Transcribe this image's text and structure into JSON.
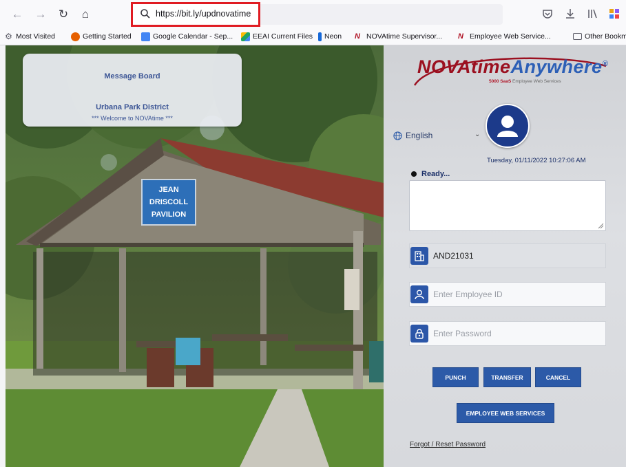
{
  "browser": {
    "url": "https://bit.ly/updnovatime",
    "bookmarks": [
      {
        "label": "Most Visited",
        "icon": "gear-icon",
        "color": "#5b5b66"
      },
      {
        "label": "Getting Started",
        "icon": "firefox-icon",
        "color": "#e66000"
      },
      {
        "label": "Google Calendar - Sep...",
        "icon": "calendar-icon",
        "color": "#4285f4"
      },
      {
        "label": "EEAI Current Files",
        "icon": "drive-icon",
        "color": "#1fa463"
      },
      {
        "label": "Neon",
        "icon": "neon-icon",
        "color": "#1668d8"
      },
      {
        "label": "NOVAtime Supervisor...",
        "icon": "novatime-icon",
        "color": "#b01527"
      },
      {
        "label": "Employee Web Service...",
        "icon": "novatime-icon",
        "color": "#b01527"
      },
      {
        "label": "Other Bookm",
        "icon": "folder-icon",
        "color": "#5b5b66"
      }
    ]
  },
  "message_board": {
    "title": "Message Board",
    "line1": "Urbana Park District",
    "line2": "*** Welcome to NOVAtime ***"
  },
  "photo": {
    "sign_lines": [
      "JEAN",
      "DRISCOLL",
      "PAVILION"
    ]
  },
  "login": {
    "logo_part1": "NOVAtime",
    "logo_part2": "Anywhere",
    "logo_reg": "®",
    "logo_sub_bold": "5000 SaaS",
    "logo_sub_rest": "Employee Web Services",
    "language": "English",
    "datetime": "Tuesday, 01/11/2022 10:27:06 AM",
    "status": "Ready...",
    "company_code": "AND21031",
    "employee_placeholder": "Enter Employee ID",
    "password_placeholder": "Enter Password",
    "buttons": {
      "punch": "PUNCH",
      "transfer": "TRANSFER",
      "cancel": "CANCEL",
      "employee_web_services": "EMPLOYEE WEB SERVICES"
    },
    "forgot_link": "Forgot / Reset Password"
  },
  "colors": {
    "accent": "#2c5aa8",
    "brand_red": "#9b1020",
    "brand_blue": "#2c5fb6",
    "url_highlight": "#e01b22"
  }
}
